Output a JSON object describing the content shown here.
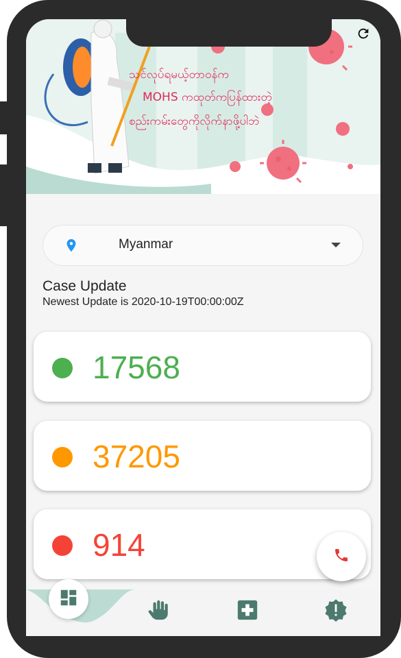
{
  "banner": {
    "line1": "သင်လုပ်ရမယ့်တာဝန်က",
    "line2": "MOHS ကထုတ်ကပြန်ထားတဲ့",
    "line3": "စည်းကမ်းတွေကိုလိုက်နာဖို့ပါဘဲ"
  },
  "header": {
    "refresh_icon": "refresh-icon"
  },
  "country_select": {
    "value": "Myanmar",
    "icon": "location-pin-icon"
  },
  "case_update": {
    "title": "Case Update",
    "subtitle": "Newest Update is 2020-10-19T00:00:00Z"
  },
  "stats": [
    {
      "value": "17568",
      "color": "#4caf50"
    },
    {
      "value": "37205",
      "color": "#ff9800"
    },
    {
      "value": "914",
      "color": "#f44336"
    }
  ],
  "call_button": {
    "icon": "phone-icon",
    "color": "#e53935"
  },
  "bottom_nav": {
    "items": [
      {
        "icon": "dashboard-icon",
        "active": true
      },
      {
        "icon": "hand-icon",
        "active": false
      },
      {
        "icon": "hospital-icon",
        "active": false
      },
      {
        "icon": "alert-icon",
        "active": false
      }
    ]
  },
  "colors": {
    "accent": "#e0285a",
    "banner_teal": "#cfe6df",
    "nav_icon": "#4c7a6e"
  }
}
